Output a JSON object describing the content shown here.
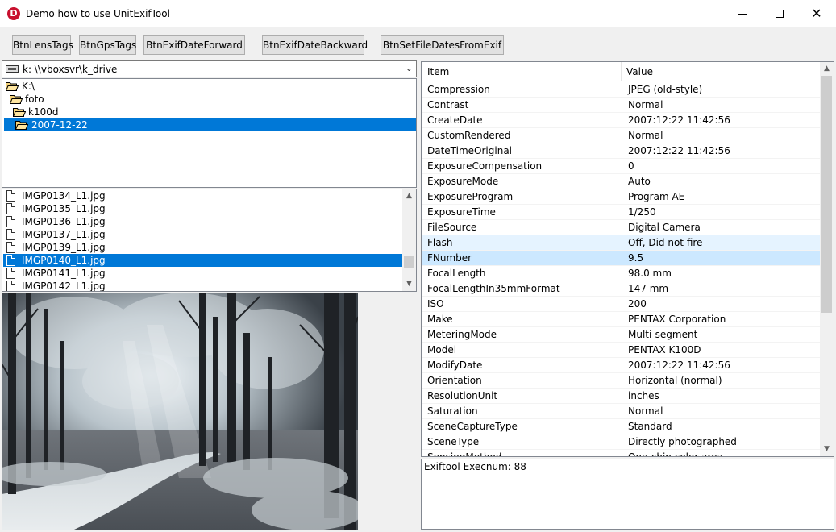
{
  "window": {
    "title": "Demo how to use UnitExifTool",
    "icon_letter": "D"
  },
  "toolbar": {
    "buttons": [
      {
        "label": "BtnLensTags"
      },
      {
        "label": "BtnGpsTags"
      },
      {
        "label": "BtnExifDateForward"
      },
      {
        "label": "BtnExifDateBackward"
      },
      {
        "label": "BtnSetFileDatesFromExif"
      }
    ]
  },
  "drive": {
    "selected": "k: \\\\vboxsvr\\k_drive"
  },
  "tree": {
    "items": [
      {
        "label": "K:\\"
      },
      {
        "label": "foto"
      },
      {
        "label": "k100d"
      },
      {
        "label": "2007-12-22",
        "selected": true
      }
    ]
  },
  "files": {
    "items": [
      {
        "name": "IMGP0134_L1.jpg"
      },
      {
        "name": "IMGP0135_L1.jpg"
      },
      {
        "name": "IMGP0136_L1.jpg"
      },
      {
        "name": "IMGP0137_L1.jpg"
      },
      {
        "name": "IMGP0139_L1.jpg"
      },
      {
        "name": "IMGP0140_L1.jpg",
        "selected": true
      },
      {
        "name": "IMGP0141_L1.jpg"
      },
      {
        "name": "IMGP0142_L1.jpg"
      }
    ]
  },
  "grid": {
    "columns": {
      "item": "Item",
      "value": "Value"
    },
    "rows": [
      {
        "item": "Compression",
        "value": "JPEG (old-style)"
      },
      {
        "item": "Contrast",
        "value": "Normal"
      },
      {
        "item": "CreateDate",
        "value": "2007:12:22 11:42:56"
      },
      {
        "item": "CustomRendered",
        "value": "Normal"
      },
      {
        "item": "DateTimeOriginal",
        "value": "2007:12:22 11:42:56"
      },
      {
        "item": "ExposureCompensation",
        "value": "0"
      },
      {
        "item": "ExposureMode",
        "value": "Auto"
      },
      {
        "item": "ExposureProgram",
        "value": "Program AE"
      },
      {
        "item": "ExposureTime",
        "value": "1/250"
      },
      {
        "item": "FileSource",
        "value": "Digital Camera"
      },
      {
        "item": "Flash",
        "value": "Off, Did not fire",
        "state": "hover"
      },
      {
        "item": "FNumber",
        "value": "9.5",
        "state": "selected"
      },
      {
        "item": "FocalLength",
        "value": "98.0 mm"
      },
      {
        "item": "FocalLengthIn35mmFormat",
        "value": "147 mm"
      },
      {
        "item": "ISO",
        "value": "200"
      },
      {
        "item": "Make",
        "value": "PENTAX Corporation"
      },
      {
        "item": "MeteringMode",
        "value": "Multi-segment"
      },
      {
        "item": "Model",
        "value": "PENTAX K100D"
      },
      {
        "item": "ModifyDate",
        "value": "2007:12:22 11:42:56"
      },
      {
        "item": "Orientation",
        "value": "Horizontal (normal)"
      },
      {
        "item": "ResolutionUnit",
        "value": "inches"
      },
      {
        "item": "Saturation",
        "value": "Normal"
      },
      {
        "item": "SceneCaptureType",
        "value": "Standard"
      },
      {
        "item": "SceneType",
        "value": "Directly photographed"
      },
      {
        "item": "SensingMethod",
        "value": "One-chip color area"
      }
    ]
  },
  "status": {
    "text": "Exiftool Execnum: 88"
  },
  "colors": {
    "selection": "#0078d7",
    "row_selected": "#cce8ff",
    "row_hover": "#e5f3ff"
  }
}
